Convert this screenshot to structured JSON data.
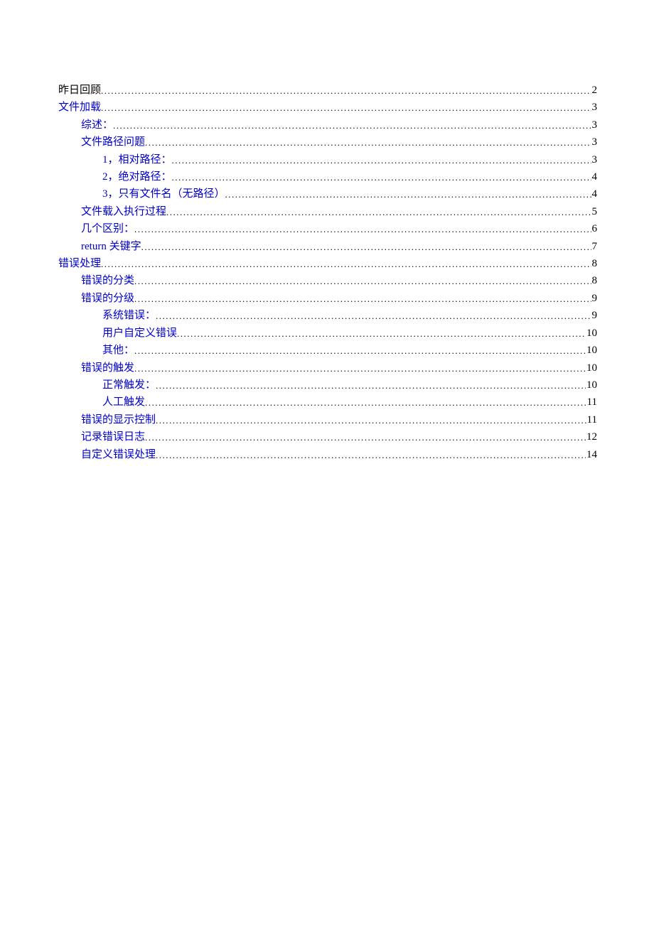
{
  "toc": [
    {
      "level": 1,
      "label": "昨日回顾",
      "page": "2",
      "link": false
    },
    {
      "level": 1,
      "label": "文件加载",
      "page": "3",
      "link": true
    },
    {
      "level": 2,
      "label": "综述：",
      "page": "3",
      "link": true
    },
    {
      "level": 2,
      "label": "文件路径问题",
      "page": "3",
      "link": true
    },
    {
      "level": 3,
      "label": "1，相对路径：",
      "page": "3",
      "link": true
    },
    {
      "level": 3,
      "label": "2，绝对路径：",
      "page": "4",
      "link": true
    },
    {
      "level": 3,
      "label": "3，只有文件名（无路径）",
      "page": "4",
      "link": true
    },
    {
      "level": 2,
      "label": "文件载入执行过程",
      "page": "5",
      "link": true
    },
    {
      "level": 2,
      "label": "几个区别：",
      "page": "6",
      "link": true
    },
    {
      "level": 2,
      "label": "return 关键字",
      "page": "7",
      "link": true
    },
    {
      "level": 1,
      "label": "错误处理",
      "page": "8",
      "link": true
    },
    {
      "level": 2,
      "label": "错误的分类",
      "page": "8",
      "link": true
    },
    {
      "level": 2,
      "label": "错误的分级",
      "page": "9",
      "link": true
    },
    {
      "level": 3,
      "label": "系统错误：",
      "page": "9",
      "link": true
    },
    {
      "level": 3,
      "label": "用户自定义错误",
      "page": "10",
      "link": true
    },
    {
      "level": 3,
      "label": "其他：",
      "page": "10",
      "link": true
    },
    {
      "level": 2,
      "label": "错误的触发",
      "page": "10",
      "link": true
    },
    {
      "level": 3,
      "label": "正常触发：",
      "page": "10",
      "link": true
    },
    {
      "level": 3,
      "label": "人工触发",
      "page": "11",
      "link": true
    },
    {
      "level": 2,
      "label": "错误的显示控制",
      "page": "11",
      "link": true
    },
    {
      "level": 2,
      "label": "记录错误日志",
      "page": "12",
      "link": true
    },
    {
      "level": 2,
      "label": "自定义错误处理",
      "page": "14",
      "link": true
    }
  ]
}
